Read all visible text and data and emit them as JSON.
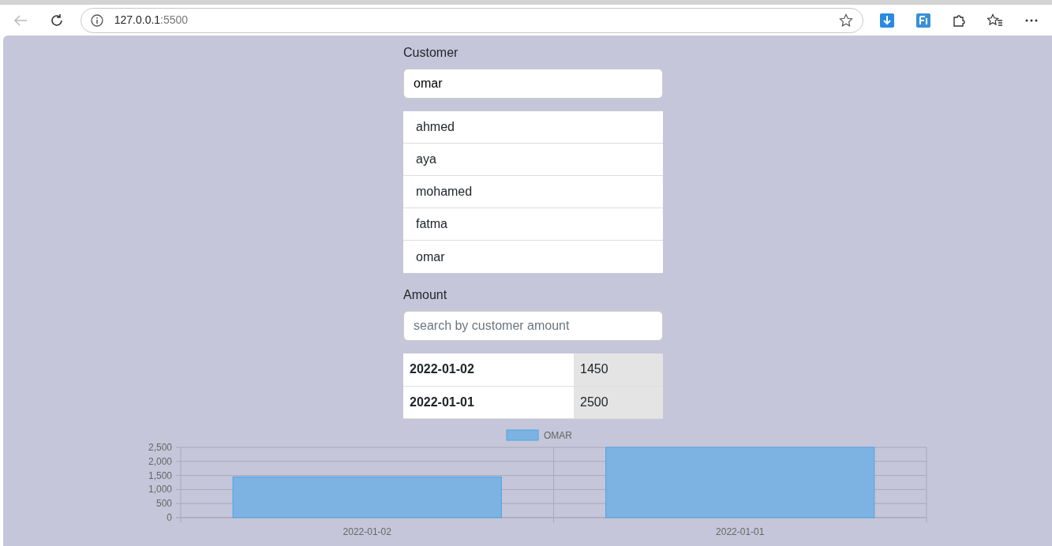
{
  "browser": {
    "url_host": "127.0.0.1",
    "url_port": ":5500"
  },
  "customer_label": "Customer",
  "customer_input": {
    "value": "omar"
  },
  "customers": [
    {
      "name": "ahmed"
    },
    {
      "name": "aya"
    },
    {
      "name": "mohamed"
    },
    {
      "name": "fatma"
    },
    {
      "name": "omar"
    }
  ],
  "amount_label": "Amount",
  "amount_input": {
    "placeholder": "search by customer amount"
  },
  "transactions": [
    {
      "date": "2022-01-02",
      "amount": "1450"
    },
    {
      "date": "2022-01-01",
      "amount": "2500"
    }
  ],
  "chart": {
    "chart_data": {
      "type": "bar",
      "grid": true,
      "categories": [
        "2022-01-02",
        "2022-01-01"
      ],
      "series": [
        {
          "name": "OMAR",
          "color": "#7db3e2",
          "values": [
            1450,
            2500
          ]
        }
      ],
      "ylim": [
        0,
        2500
      ],
      "yticks": [
        {
          "value": 0,
          "label": "0"
        },
        {
          "value": 500,
          "label": "500"
        },
        {
          "value": 1000,
          "label": "1,000"
        },
        {
          "value": 1500,
          "label": "1,500"
        },
        {
          "value": 2000,
          "label": "2,000"
        },
        {
          "value": 2500,
          "label": "2,500"
        }
      ]
    }
  }
}
